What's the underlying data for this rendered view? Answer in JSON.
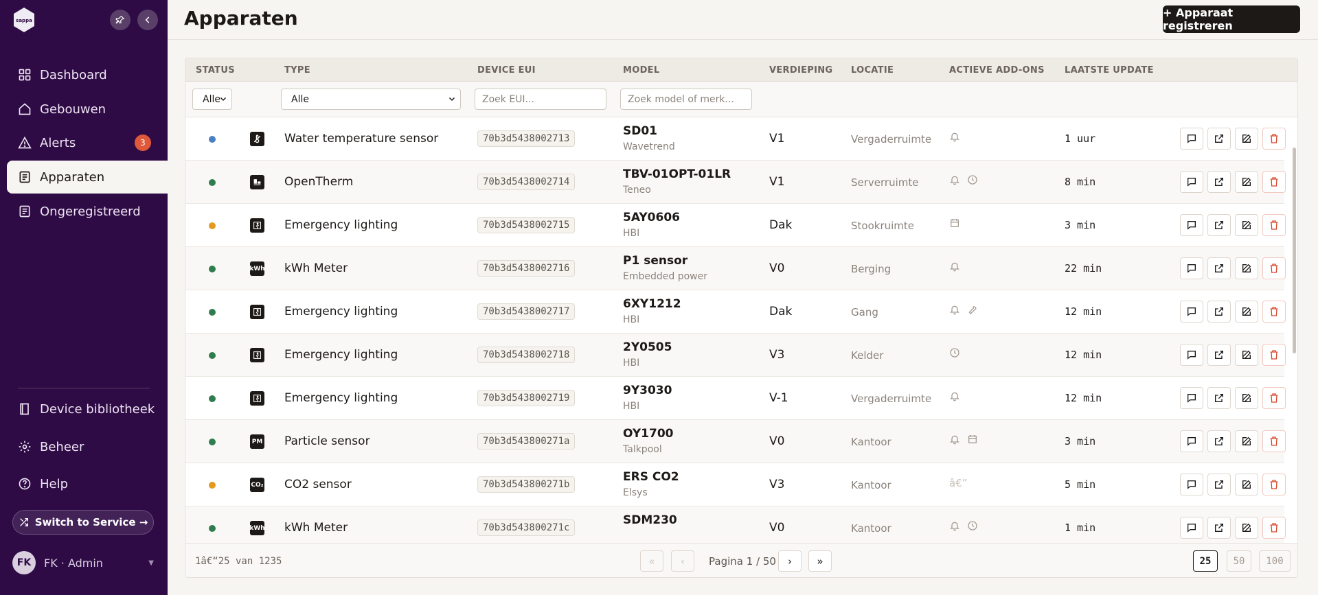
{
  "sidebar": {
    "logo_text": "sappa",
    "nav": [
      {
        "label": "Dashboard",
        "icon": "grid-icon"
      },
      {
        "label": "Gebouwen",
        "icon": "home-icon"
      },
      {
        "label": "Alerts",
        "icon": "warning-icon",
        "badge": "3"
      },
      {
        "label": "Apparaten",
        "icon": "device-icon",
        "active": true
      },
      {
        "label": "Ongeregistreerd",
        "icon": "device-icon"
      }
    ],
    "bottom_nav": [
      {
        "label": "Device bibliotheek",
        "icon": "book-icon"
      },
      {
        "label": "Beheer",
        "icon": "gear-icon"
      },
      {
        "label": "Help",
        "icon": "help-icon"
      }
    ],
    "switch_label": "Switch to Service →",
    "user": {
      "initials": "FK",
      "name": "FK · Admin"
    }
  },
  "header": {
    "title": "Apparaten",
    "register_label": "+ Apparaat registreren"
  },
  "table": {
    "columns": [
      "STATUS",
      "TYPE",
      "DEVICE EUI",
      "MODEL",
      "VERDIEPING",
      "LOCATIE",
      "ACTIEVE ADD-ONS",
      "LAATSTE UPDATE"
    ],
    "filters": {
      "status_value": "Alle",
      "type_value": "Alle",
      "eui_placeholder": "Zoek EUI...",
      "model_placeholder": "Zoek model of merk..."
    },
    "rows": [
      {
        "status_color": "#4a7fc1",
        "type_icon": "water-temp-icon",
        "type": "Water temperature sensor",
        "eui": "70b3d5438002713",
        "model": "SD01",
        "brand": "Wavetrend",
        "floor": "V1",
        "location": "Vergaderruimte",
        "addons": [
          "bell"
        ],
        "update": "1 uur"
      },
      {
        "status_color": "#2f7d4f",
        "type_icon": "thermostat-icon",
        "type": "OpenTherm",
        "eui": "70b3d5438002714",
        "model": "TBV-01OPT-01LR",
        "brand": "Teneo",
        "floor": "V1",
        "location": "Serverruimte",
        "addons": [
          "bell",
          "clock"
        ],
        "update": "8 min"
      },
      {
        "status_color": "#e39a1e",
        "type_icon": "emergency-exit-icon",
        "type": "Emergency lighting",
        "eui": "70b3d5438002715",
        "model": "5AY0606",
        "brand": "HBI",
        "floor": "Dak",
        "location": "Stookruimte",
        "addons": [
          "calendar"
        ],
        "update": "3 min"
      },
      {
        "status_color": "#2f7d4f",
        "type_icon": "kwh-icon",
        "type": "kWh Meter",
        "eui": "70b3d5438002716",
        "model": "P1 sensor",
        "brand": "Embedded power",
        "floor": "V0",
        "location": "Berging",
        "addons": [
          "bell"
        ],
        "update": "22 min"
      },
      {
        "status_color": "#2f7d4f",
        "type_icon": "emergency-exit-icon",
        "type": "Emergency lighting",
        "eui": "70b3d5438002717",
        "model": "6XY1212",
        "brand": "HBI",
        "floor": "Dak",
        "location": "Gang",
        "addons": [
          "bell",
          "wrench"
        ],
        "update": "12 min"
      },
      {
        "status_color": "#2f7d4f",
        "type_icon": "emergency-exit-icon",
        "type": "Emergency lighting",
        "eui": "70b3d5438002718",
        "model": "2Y0505",
        "brand": "HBI",
        "floor": "V3",
        "location": "Kelder",
        "addons": [
          "clock"
        ],
        "update": "12 min"
      },
      {
        "status_color": "#2f7d4f",
        "type_icon": "emergency-exit-icon",
        "type": "Emergency lighting",
        "eui": "70b3d5438002719",
        "model": "9Y3030",
        "brand": "HBI",
        "floor": "V-1",
        "location": "Vergaderruimte",
        "addons": [
          "bell"
        ],
        "update": "12 min"
      },
      {
        "status_color": "#2f7d4f",
        "type_icon": "particle-icon",
        "type": "Particle sensor",
        "eui": "70b3d543800271a",
        "model": "OY1700",
        "brand": "Talkpool",
        "floor": "V0",
        "location": "Kantoor",
        "addons": [
          "bell",
          "calendar"
        ],
        "update": "3 min"
      },
      {
        "status_color": "#e39a1e",
        "type_icon": "co2-icon",
        "type": "CO2 sensor",
        "eui": "70b3d543800271b",
        "model": "ERS CO2",
        "brand": "Elsys",
        "floor": "V3",
        "location": "Kantoor",
        "addons_text": "â€”",
        "addons": [],
        "update": "5 min"
      },
      {
        "status_color": "#2f7d4f",
        "type_icon": "kwh-icon",
        "type": "kWh Meter",
        "eui": "70b3d543800271c",
        "model": "SDM230",
        "brand": "",
        "floor": "V0",
        "location": "Kantoor",
        "addons": [
          "bell",
          "clock"
        ],
        "update": "1 min"
      }
    ]
  },
  "footer": {
    "range": "1â€“25 van 1235",
    "page_label": "Pagina 1 / 50",
    "first": "«",
    "prev": "‹",
    "next": "›",
    "last": "»",
    "page_sizes": [
      "25",
      "50",
      "100"
    ]
  }
}
